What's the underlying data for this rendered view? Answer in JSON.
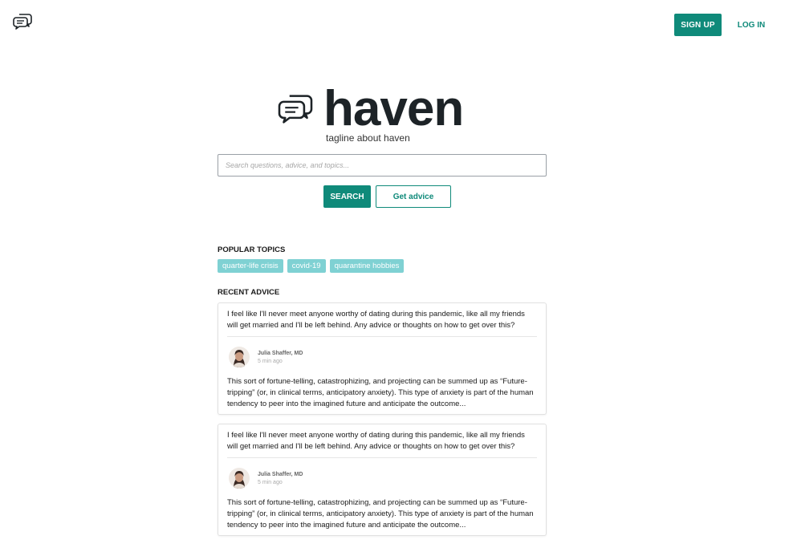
{
  "nav": {
    "logo_icon": "chat-bubbles-icon",
    "signup_label": "SIGN UP",
    "login_label": "LOG IN"
  },
  "hero": {
    "logo_icon": "chat-bubbles-icon",
    "brand": "haven",
    "tagline": "tagline about haven"
  },
  "search": {
    "placeholder": "Search questions, advice, and topics...",
    "value": "",
    "search_label": "SEARCH",
    "advice_label": "Get advice"
  },
  "popular": {
    "heading": "POPULAR TOPICS",
    "topics": [
      "quarter-life crisis",
      "covid-19",
      "quarantine hobbies"
    ]
  },
  "recent": {
    "heading": "RECENT ADVICE",
    "cards": [
      {
        "question": "I feel like I'll never meet anyone worthy of dating during this pandemic, like all my friends will get married and I'll be left behind. Any advice or thoughts on how to get over this?",
        "author": "Julia Shaffer, MD",
        "time": "5 min ago",
        "answer": "This sort of fortune-telling, catastrophizing, and projecting can be summed up as “Future-tripping” (or, in clinical terms, anticipatory anxiety). This type of anxiety is part of the human tendency to peer into the imagined future and anticipate the outcome..."
      },
      {
        "question": "I feel like I'll never meet anyone worthy of dating during this pandemic, like all my friends will get married and I'll be left behind. Any advice or thoughts on how to get over this?",
        "author": "Julia Shaffer, MD",
        "time": "5 min ago",
        "answer": "This sort of fortune-telling, catastrophizing, and projecting can be summed up as “Future-tripping” (or, in clinical terms, anticipatory anxiety). This type of anxiety is part of the human tendency to peer into the imagined future and anticipate the outcome..."
      }
    ]
  },
  "colors": {
    "accent": "#0f8a7a",
    "tag": "#7fd1d3",
    "text": "#1d2327"
  }
}
